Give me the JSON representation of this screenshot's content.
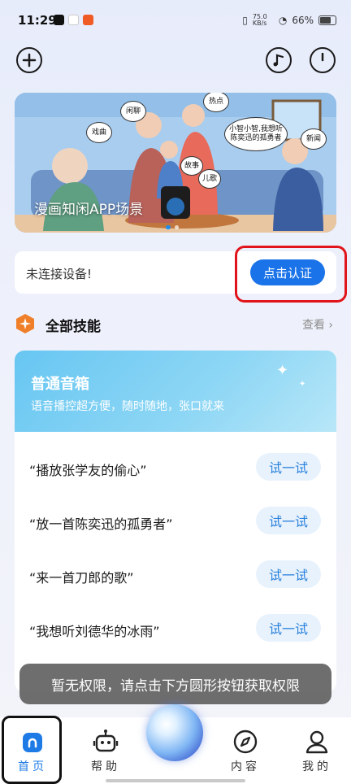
{
  "status_bar": {
    "time": "11:29",
    "network": "75.0 KB/s",
    "battery": "66%"
  },
  "top_bar": {
    "add_icon": "plus-circle-icon",
    "music_icon": "music-note-icon",
    "power_icon": "power-icon"
  },
  "banner": {
    "caption": "漫画知闲APP场景",
    "bubbles": [
      "戏曲",
      "闲聊",
      "热点",
      "小智小智,我想听陈奕迅的孤勇者",
      "新闻",
      "故事",
      "儿歌"
    ]
  },
  "device": {
    "status": "未连接设备!",
    "auth_button": "点击认证"
  },
  "skills": {
    "title": "全部技能",
    "view": "查看"
  },
  "skill_card": {
    "title": "普通音箱",
    "subtitle": "语音播控超方便，随时随地，张口就来",
    "examples": [
      {
        "text": "“播放张学友的偷心”",
        "button": "试一试"
      },
      {
        "text": "“放一首陈奕迅的孤勇者”",
        "button": "试一试"
      },
      {
        "text": "“来一首刀郎的歌”",
        "button": "试一试"
      },
      {
        "text": "“我想听刘德华的冰雨”",
        "button": "试一试"
      }
    ]
  },
  "toast": "暂无权限，请点击下方圆形按钮获取权限",
  "tabs": [
    {
      "label": "首页",
      "icon": "home-icon"
    },
    {
      "label": "帮助",
      "icon": "robot-icon"
    },
    {
      "label": "内容",
      "icon": "compass-icon"
    },
    {
      "label": "我的",
      "icon": "user-icon"
    }
  ],
  "colors": {
    "accent": "#1a73e8",
    "highlight_red": "#e0141a",
    "skill_header": "#67c6f2"
  }
}
